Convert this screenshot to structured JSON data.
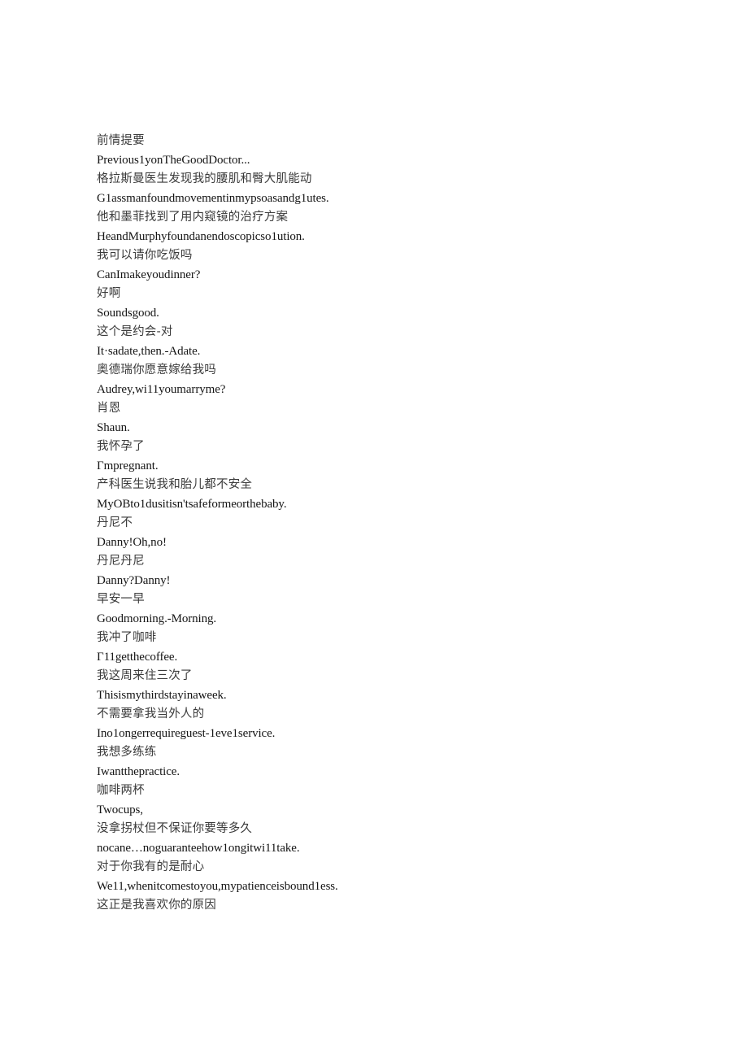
{
  "document": {
    "kind": "bilingual-subtitle-transcript",
    "background_color": "#ffffff",
    "chinese_text_color": "#3a3a3a",
    "english_text_color": "#151515",
    "lines": [
      {
        "lang": "zh",
        "text": "前情提要"
      },
      {
        "lang": "en",
        "text": "Previous1yonTheGoodDoctor..."
      },
      {
        "lang": "zh",
        "text": "格拉斯曼医生发现我的腰肌和臀大肌能动"
      },
      {
        "lang": "en",
        "text": "G1assmanfoundmovementinmypsoasandg1utes."
      },
      {
        "lang": "zh",
        "text": "他和墨菲找到了用内窥镜的治疗方案"
      },
      {
        "lang": "en",
        "text": "HeandMurphyfoundanendoscopicso1ution."
      },
      {
        "lang": "zh",
        "text": "我可以请你吃饭吗"
      },
      {
        "lang": "en",
        "text": "CanImakeyoudinner?"
      },
      {
        "lang": "zh",
        "text": "好啊"
      },
      {
        "lang": "en",
        "text": "Soundsgood."
      },
      {
        "lang": "zh",
        "text": "这个是约会-对"
      },
      {
        "lang": "en",
        "text": "It·sadate,then.-Adate."
      },
      {
        "lang": "zh",
        "text": "奥德瑞你愿意嫁给我吗"
      },
      {
        "lang": "en",
        "text": "Audrey,wi11youmarryme?"
      },
      {
        "lang": "zh",
        "text": "肖恩"
      },
      {
        "lang": "en",
        "text": "Shaun."
      },
      {
        "lang": "zh",
        "text": "我怀孕了"
      },
      {
        "lang": "en",
        "text": "Γmpregnant."
      },
      {
        "lang": "zh",
        "text": "产科医生说我和胎儿都不安全"
      },
      {
        "lang": "en",
        "text": "MyOBto1dusitisn'tsafeformeorthebaby."
      },
      {
        "lang": "zh",
        "text": "丹尼不"
      },
      {
        "lang": "en",
        "text": "Danny!Oh,no!"
      },
      {
        "lang": "zh",
        "text": "丹尼丹尼"
      },
      {
        "lang": "en",
        "text": "Danny?Danny!"
      },
      {
        "lang": "zh",
        "text": "早安一早"
      },
      {
        "lang": "en",
        "text": "Goodmorning.-Morning."
      },
      {
        "lang": "zh",
        "text": "我冲了咖啡"
      },
      {
        "lang": "en",
        "text": "Γ11getthecoffee."
      },
      {
        "lang": "zh",
        "text": "我这周来住三次了"
      },
      {
        "lang": "en",
        "text": "Thisismythirdstayinaweek."
      },
      {
        "lang": "zh",
        "text": "不需要拿我当外人的"
      },
      {
        "lang": "en",
        "text": "Ino1ongerrequireguest-1eve1service."
      },
      {
        "lang": "zh",
        "text": "我想多练练"
      },
      {
        "lang": "en",
        "text": "Iwantthepractice."
      },
      {
        "lang": "zh",
        "text": "咖啡两杯"
      },
      {
        "lang": "en",
        "text": "Twocups,"
      },
      {
        "lang": "zh",
        "text": "没拿拐杖但不保证你要等多久"
      },
      {
        "lang": "en",
        "text": "nocane…noguaranteehow1ongitwi11take."
      },
      {
        "lang": "zh",
        "text": "对于你我有的是耐心"
      },
      {
        "lang": "en",
        "text": "We11,whenitcomestoyou,mypatienceisbound1ess."
      },
      {
        "lang": "zh",
        "text": "这正是我喜欢你的原因"
      }
    ]
  }
}
